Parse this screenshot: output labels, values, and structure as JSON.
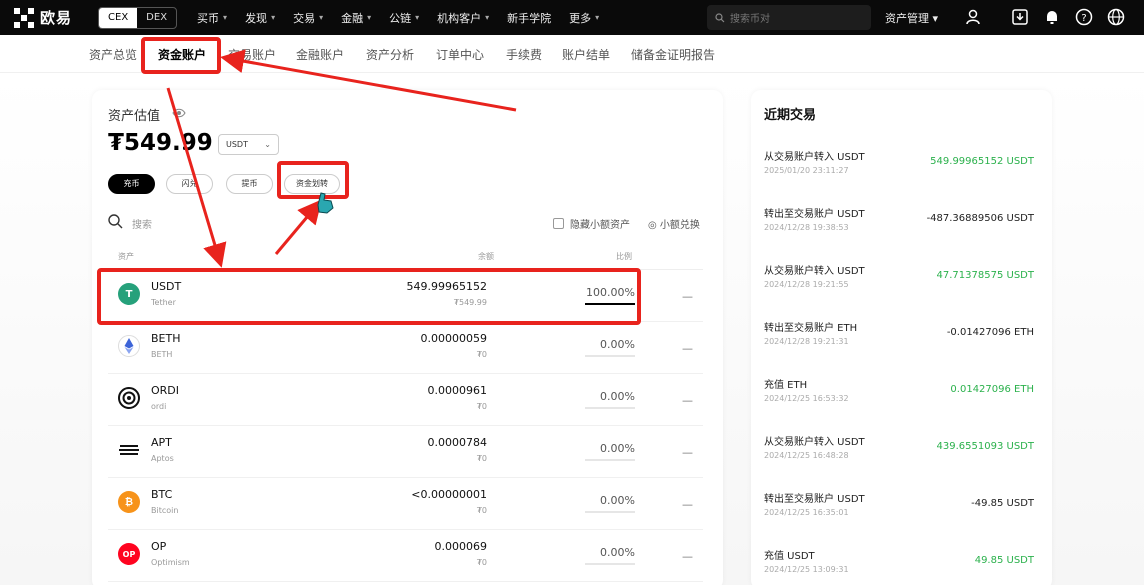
{
  "topbar": {
    "logo_text": "欧易",
    "switch": [
      "CEX",
      "DEX"
    ],
    "nav": [
      {
        "label": "买币",
        "chev": true
      },
      {
        "label": "发现",
        "chev": true
      },
      {
        "label": "交易",
        "chev": true
      },
      {
        "label": "金融",
        "chev": true
      },
      {
        "label": "公链",
        "chev": true
      },
      {
        "label": "机构客户",
        "chev": true
      },
      {
        "label": "新手学院",
        "chev": false
      },
      {
        "label": "更多",
        "chev": true
      }
    ],
    "search_placeholder": "搜索币对",
    "asset_mgmt": "资产管理 ▾"
  },
  "subnav": [
    "资产总览",
    "资金账户",
    "交易账户",
    "金融账户",
    "资产分析",
    "订单中心",
    "手续费",
    "账户结单",
    "储备金证明报告"
  ],
  "subnav_active": 1,
  "summary": {
    "label": "资产估值",
    "balance": "₮549.99",
    "unit": "USDT"
  },
  "actions": [
    "充币",
    "闪兑",
    "提币",
    "资金划转"
  ],
  "filter": {
    "search": "搜索",
    "hide_small": "隐藏小额资产",
    "small_exchange": "小额兑换"
  },
  "table": {
    "headers": [
      "资产",
      "余额",
      "比例"
    ],
    "rows": [
      {
        "symbol": "USDT",
        "name": "Tether",
        "amount": "549.99965152",
        "value": "₮549.99",
        "pct": "100.00%",
        "pct_value": 1.0,
        "color": "#26a17b",
        "glyph": "T"
      },
      {
        "symbol": "BETH",
        "name": "BETH",
        "amount": "0.00000059",
        "value": "₮0",
        "pct": "0.00%",
        "pct_value": 0,
        "color": "#ffffff",
        "glyph": "eth"
      },
      {
        "symbol": "ORDI",
        "name": "ordi",
        "amount": "0.0000961",
        "value": "₮0",
        "pct": "0.00%",
        "pct_value": 0,
        "color": "#000000",
        "glyph": "ordi"
      },
      {
        "symbol": "APT",
        "name": "Aptos",
        "amount": "0.0000784",
        "value": "₮0",
        "pct": "0.00%",
        "pct_value": 0,
        "color": "#000000",
        "glyph": "apt"
      },
      {
        "symbol": "BTC",
        "name": "Bitcoin",
        "amount": "<0.00000001",
        "value": "₮0",
        "pct": "0.00%",
        "pct_value": 0,
        "color": "#f7931a",
        "glyph": "₿"
      },
      {
        "symbol": "OP",
        "name": "Optimism",
        "amount": "0.000069",
        "value": "₮0",
        "pct": "0.00%",
        "pct_value": 0,
        "color": "#ff0420",
        "glyph": "OP"
      }
    ],
    "dash": "—"
  },
  "recent": {
    "title": "近期交易",
    "items": [
      {
        "title": "从交易账户转入 USDT",
        "time": "2025/01/20 23:11:27",
        "amount": "549.99965152 USDT",
        "positive": true
      },
      {
        "title": "转出至交易账户 USDT",
        "time": "2024/12/28 19:38:53",
        "amount": "-487.36889506 USDT",
        "positive": false
      },
      {
        "title": "从交易账户转入 USDT",
        "time": "2024/12/28 19:21:55",
        "amount": "47.71378575 USDT",
        "positive": true
      },
      {
        "title": "转出至交易账户 ETH",
        "time": "2024/12/28 19:21:31",
        "amount": "-0.01427096 ETH",
        "positive": false
      },
      {
        "title": "充值 ETH",
        "time": "2024/12/25 16:53:32",
        "amount": "0.01427096 ETH",
        "positive": true
      },
      {
        "title": "从交易账户转入 USDT",
        "time": "2024/12/25 16:48:28",
        "amount": "439.6551093 USDT",
        "positive": true
      },
      {
        "title": "转出至交易账户 USDT",
        "time": "2024/12/25 16:35:01",
        "amount": "-49.85 USDT",
        "positive": false
      },
      {
        "title": "充值 USDT",
        "time": "2024/12/25 13:09:31",
        "amount": "49.85 USDT",
        "positive": true
      }
    ]
  },
  "colors": {
    "accent": "#000000",
    "positive": "#2bb14c",
    "annotation": "#e8231d"
  }
}
